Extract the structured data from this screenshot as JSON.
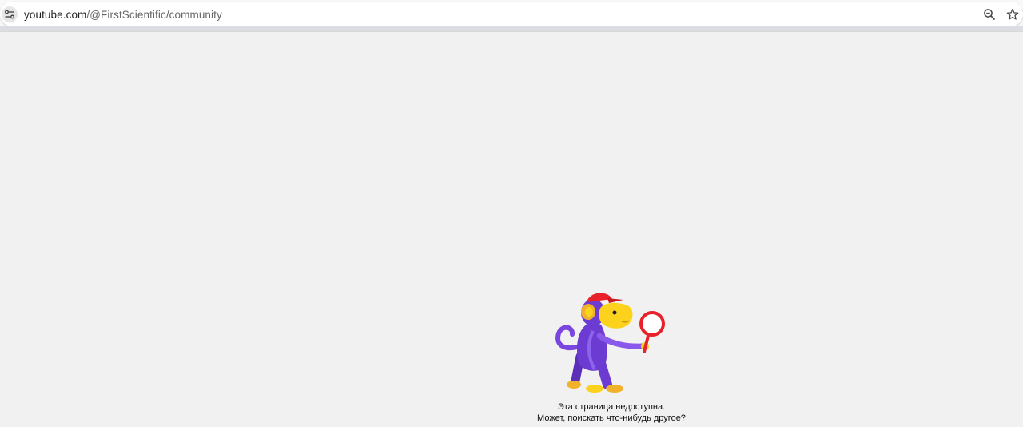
{
  "browser": {
    "url_domain": "youtube.com",
    "url_path": "/@FirstScientific/community",
    "icons": {
      "site_info": "tune-icon",
      "zoom": "zoom-icon",
      "bookmark": "star-icon"
    }
  },
  "page": {
    "background_color": "#f1f1f1",
    "message_line1": "Эта страница недоступна.",
    "message_line2": "Может, поискать что-нибудь другое?",
    "illustration": "monkey-with-magnifier-icon"
  },
  "colors": {
    "monkey_body": "#6c3bd1",
    "monkey_face": "#fcd21c",
    "cap": "#e8212b",
    "magnifier": "#e8212b"
  }
}
